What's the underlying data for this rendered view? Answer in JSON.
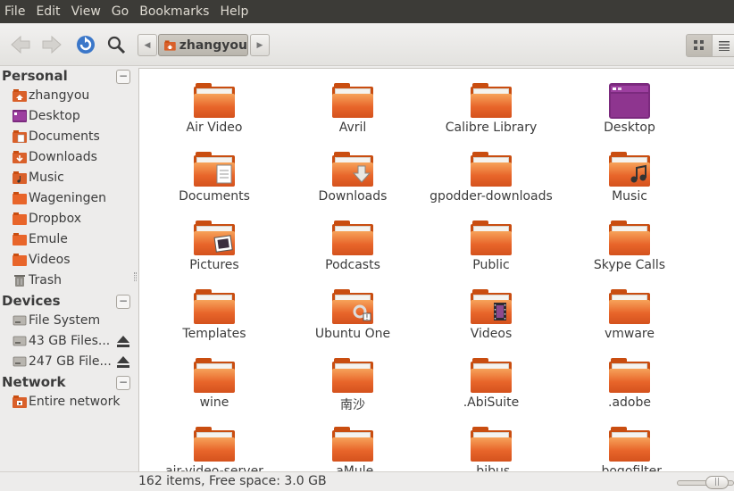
{
  "menu": [
    "File",
    "Edit",
    "View",
    "Go",
    "Bookmarks",
    "Help"
  ],
  "toolbar": {
    "back_icon": "back-arrow-icon",
    "forward_icon": "forward-arrow-icon",
    "reload_icon": "reload-icon",
    "search_icon": "search-icon",
    "breadcrumb": "zhangyou",
    "view_modes": [
      "icon-view",
      "list-view"
    ]
  },
  "sidebar": {
    "personal_title": "Personal",
    "personal": [
      "zhangyou",
      "Desktop",
      "Documents",
      "Downloads",
      "Music",
      "Wageningen",
      "Dropbox",
      "Emule",
      "Videos",
      "Trash"
    ],
    "devices_title": "Devices",
    "devices": [
      "File System",
      "43 GB Files...",
      "247 GB File..."
    ],
    "network_title": "Network",
    "network": [
      "Entire network"
    ]
  },
  "files": [
    "Air Video",
    "Avril",
    "Calibre Library",
    "Desktop",
    "Documents",
    "Downloads",
    "gpodder-downloads",
    "Music",
    "Pictures",
    "Podcasts",
    "Public",
    "Skype Calls",
    "Templates",
    "Ubuntu One",
    "Videos",
    "vmware",
    "wine",
    "南沙",
    ".AbiSuite",
    ".adobe",
    "air-video-server",
    ".aMule",
    ".bibus",
    ".bogofilter"
  ],
  "status": {
    "text": "162 items, Free space: 3.0 GB"
  },
  "colors": {
    "menubar": "#3c3b37",
    "folder_orange": "#e8652a",
    "accent": "#dd4814"
  }
}
